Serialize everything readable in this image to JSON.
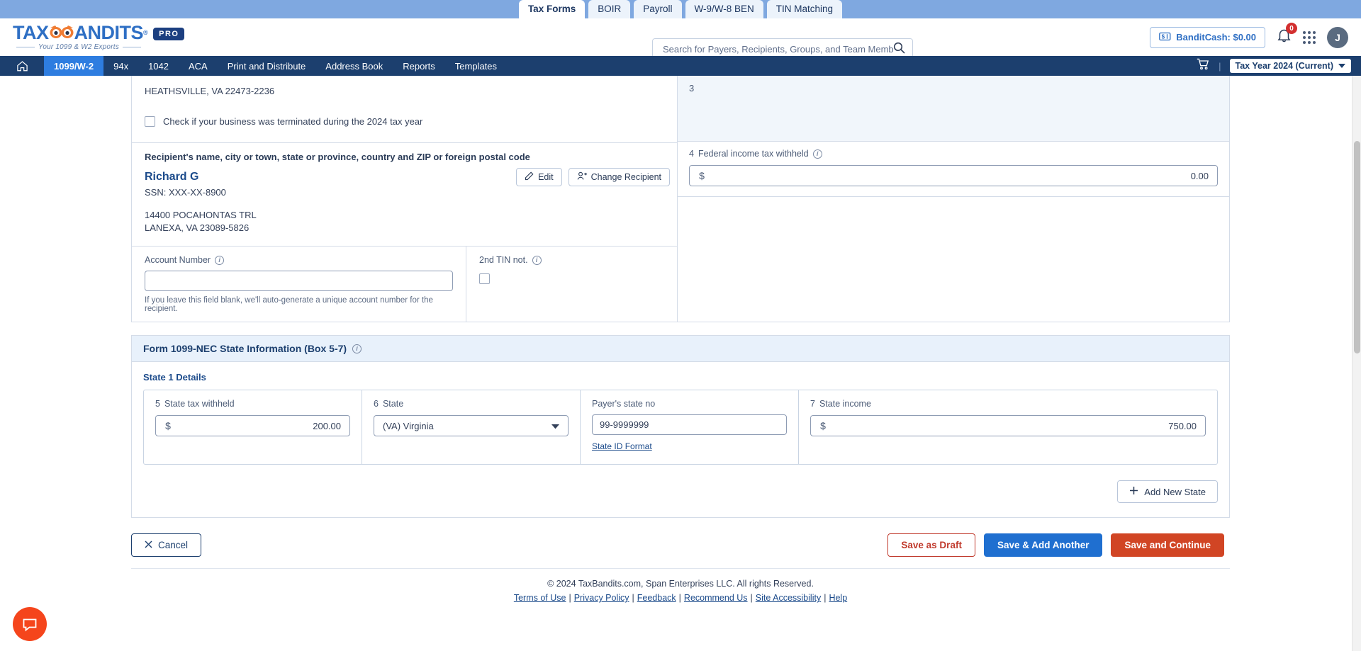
{
  "product_tabs": [
    {
      "label": "Tax Forms",
      "active": true
    },
    {
      "label": "BOIR",
      "active": false
    },
    {
      "label": "Payroll",
      "active": false
    },
    {
      "label": "W-9/W-8 BEN",
      "active": false
    },
    {
      "label": "TIN Matching",
      "active": false
    }
  ],
  "brand": {
    "name_part1": "TAX",
    "name_part2": "ANDITS",
    "tm": "®",
    "pro": "PRO",
    "tagline": "Your 1099 & W2 Exports"
  },
  "search": {
    "placeholder": "Search for Payers, Recipients, Groups, and Team Members",
    "value": "",
    "icon": "search-icon"
  },
  "header_actions": {
    "bandit_cash_label": "BanditCash: $0.00",
    "notification_count": "0",
    "avatar_initial": "J",
    "apps_icon": "grid-apps-icon",
    "bell_icon": "bell-icon",
    "cash_icon": "money-icon"
  },
  "nav": {
    "home_icon": "home-icon",
    "items": [
      {
        "label": "1099/W-2",
        "active": true
      },
      {
        "label": "94x",
        "active": false
      },
      {
        "label": "1042",
        "active": false
      },
      {
        "label": "ACA",
        "active": false
      },
      {
        "label": "Print and Distribute",
        "active": false
      },
      {
        "label": "Address Book",
        "active": false
      },
      {
        "label": "Reports",
        "active": false
      },
      {
        "label": "Templates",
        "active": false
      }
    ],
    "cart_icon": "cart-icon",
    "separator": "|",
    "tax_year": "Tax Year 2024 (Current)"
  },
  "payer": {
    "city_state_zip": "HEATHSVILLE, VA 22473-2236",
    "terminated_checkbox_label": "Check if your business was terminated during the 2024 tax year",
    "terminated_checked": false
  },
  "recipient": {
    "section_heading": "Recipient's name, city or town, state or province, country and ZIP or foreign postal code",
    "name": "Richard G",
    "ssn": "SSN: XXX-XX-8900",
    "address_line1": "14400 POCAHONTAS TRL",
    "address_line2": "LANEXA, VA 23089-5826",
    "edit_button": "Edit",
    "change_button": "Change Recipient"
  },
  "account": {
    "label": "Account Number",
    "value": "",
    "hint": "If you leave this field blank, we'll auto-generate a unique account number for the recipient."
  },
  "tin_not": {
    "label": "2nd TIN not.",
    "checked": false
  },
  "box3": {
    "number": "3"
  },
  "box4": {
    "number": "4",
    "label": "Federal income tax withheld",
    "currency": "$",
    "value": "0.00"
  },
  "state_section": {
    "title": "Form 1099-NEC  State Information  (Box 5-7)",
    "sub_heading": "State 1 Details",
    "fields": {
      "state_tax_withheld": {
        "number": "5",
        "label": "State tax withheld",
        "currency": "$",
        "value": "200.00"
      },
      "state": {
        "number": "6",
        "label": "State",
        "value": "(VA) Virginia"
      },
      "payer_state_no": {
        "label": "Payer's state no",
        "value": "99-9999999",
        "link": "State ID Format"
      },
      "state_income": {
        "number": "7",
        "label": "State income",
        "currency": "$",
        "value": "750.00"
      }
    },
    "add_new_state": "Add New State"
  },
  "actions": {
    "cancel": "Cancel",
    "save_as_draft": "Save as Draft",
    "save_add_another": "Save & Add Another",
    "save_and_continue": "Save and Continue"
  },
  "footer": {
    "copyright": "© 2024 TaxBandits.com, Span Enterprises LLC. All rights Reserved.",
    "links": [
      "Terms of Use",
      "Privacy Policy",
      "Feedback",
      "Recommend Us",
      "Site Accessibility",
      "Help"
    ],
    "separator": "|"
  },
  "chat": {
    "icon": "chat-bubble-icon"
  }
}
